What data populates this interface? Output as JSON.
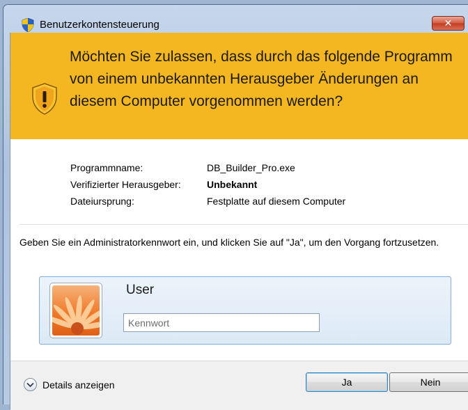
{
  "window": {
    "title": "Benutzerkontensteuerung",
    "close_glyph": "✕"
  },
  "banner": {
    "question": "Möchten Sie zulassen, dass durch das folgende Programm von einem unbekannten Herausgeber Änderungen an diesem Computer vorgenommen werden?",
    "color": "#f4b721"
  },
  "details": {
    "program_label": "Programmname:",
    "program_value": "DB_Builder_Pro.exe",
    "publisher_label": "Verifizierter Herausgeber:",
    "publisher_value": "Unbekannt",
    "origin_label": "Dateiursprung:",
    "origin_value": "Festplatte auf diesem Computer"
  },
  "prompt": "Geben Sie ein Administratorkennwort ein, und klicken Sie auf \"Ja\", um den Vorgang fortzusetzen.",
  "credential": {
    "username": "User",
    "password_placeholder": "Kennwort",
    "password_value": ""
  },
  "footer": {
    "details_toggle": "Details anzeigen",
    "yes_label": "Ja",
    "no_label": "Nein"
  },
  "icons": {
    "title_icon": "uac-shield-icon",
    "banner_icon": "warning-shield-icon",
    "toggle_icon": "chevron-down-icon",
    "avatar_icon": "flower-avatar-icon"
  }
}
